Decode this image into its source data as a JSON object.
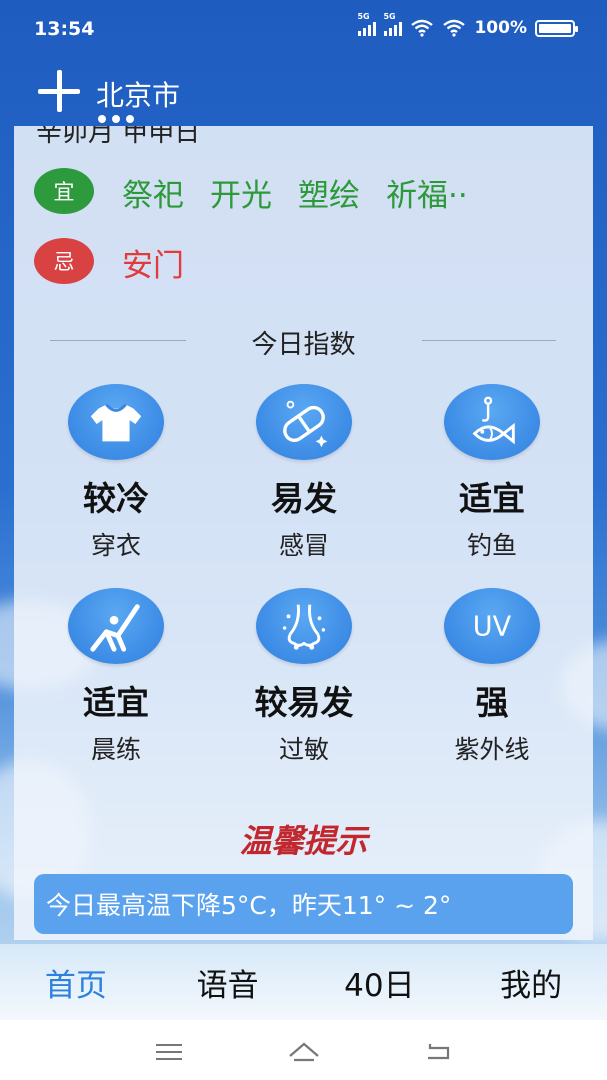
{
  "status_bar": {
    "time": "13:54",
    "net1": "5G",
    "net2": "5G",
    "battery": "100%"
  },
  "header": {
    "city": "北京市",
    "add_icon": "plus-icon"
  },
  "almanac": {
    "lunar_partial": "辛卯月 甲申日",
    "yi_label": "宜",
    "yi_items": [
      "祭祀",
      "开光",
      "塑绘",
      "祈福··"
    ],
    "ji_label": "忌",
    "ji_items": [
      "安门"
    ]
  },
  "indices": {
    "title": "今日指数",
    "items": [
      {
        "value": "较冷",
        "label": "穿衣",
        "icon": "tshirt-icon"
      },
      {
        "value": "易发",
        "label": "感冒",
        "icon": "pill-icon"
      },
      {
        "value": "适宜",
        "label": "钓鱼",
        "icon": "fishing-icon"
      },
      {
        "value": "适宜",
        "label": "晨练",
        "icon": "exercise-icon"
      },
      {
        "value": "较易发",
        "label": "过敏",
        "icon": "nose-icon"
      },
      {
        "value": "强",
        "label": "紫外线",
        "icon": "uv-icon",
        "icon_text": "UV"
      }
    ]
  },
  "tip": {
    "title": "温馨提示",
    "message": "今日最高温下降5°C，昨天11° ~ 2°"
  },
  "tabs": [
    {
      "label": "首页",
      "active": true
    },
    {
      "label": "语音",
      "active": false
    },
    {
      "label": "40日",
      "active": false
    },
    {
      "label": "我的",
      "active": false
    }
  ],
  "colors": {
    "accent": "#2d80dd",
    "yi": "#2e9a3e",
    "ji": "#d94242",
    "tip_title": "#c2272d"
  }
}
